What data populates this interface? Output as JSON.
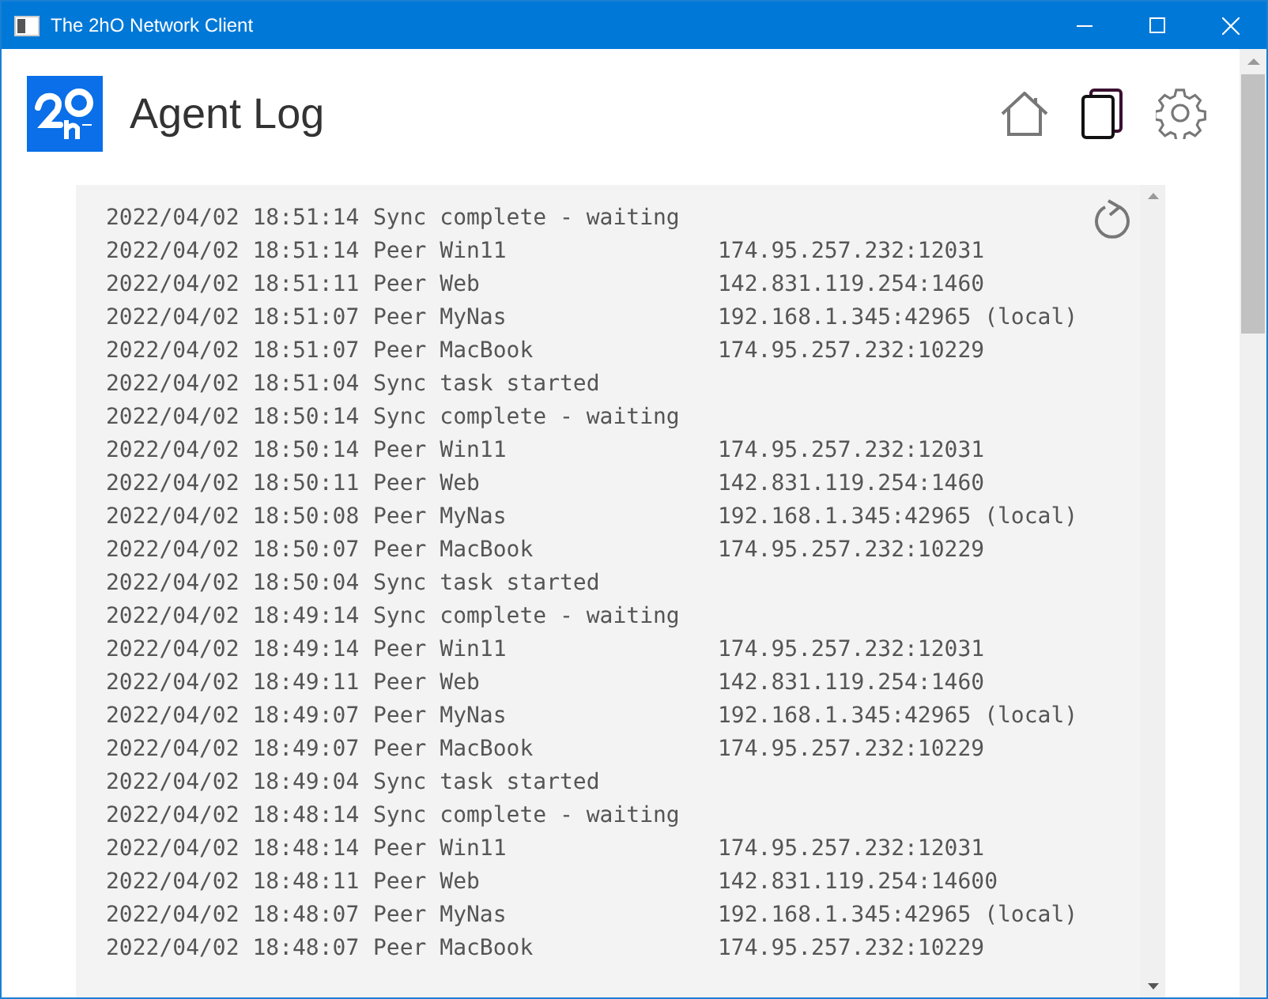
{
  "window": {
    "title": "The 2hO Network Client"
  },
  "header": {
    "title": "Agent Log"
  },
  "log": [
    {
      "time": "2022/04/02 18:51:14",
      "message": "Sync complete - waiting"
    },
    {
      "time": "2022/04/02 18:51:14",
      "message": "Peer Win11",
      "address": "174.95.257.232:12031"
    },
    {
      "time": "2022/04/02 18:51:11",
      "message": "Peer Web",
      "address": "142.831.119.254:1460"
    },
    {
      "time": "2022/04/02 18:51:07",
      "message": "Peer MyNas",
      "address": "192.168.1.345:42965 (local)"
    },
    {
      "time": "2022/04/02 18:51:07",
      "message": "Peer MacBook",
      "address": "174.95.257.232:10229"
    },
    {
      "time": "2022/04/02 18:51:04",
      "message": "Sync task started"
    },
    {
      "time": "2022/04/02 18:50:14",
      "message": "Sync complete - waiting"
    },
    {
      "time": "2022/04/02 18:50:14",
      "message": "Peer Win11",
      "address": "174.95.257.232:12031"
    },
    {
      "time": "2022/04/02 18:50:11",
      "message": "Peer Web",
      "address": "142.831.119.254:1460"
    },
    {
      "time": "2022/04/02 18:50:08",
      "message": "Peer MyNas",
      "address": "192.168.1.345:42965 (local)"
    },
    {
      "time": "2022/04/02 18:50:07",
      "message": "Peer MacBook",
      "address": "174.95.257.232:10229"
    },
    {
      "time": "2022/04/02 18:50:04",
      "message": "Sync task started"
    },
    {
      "time": "2022/04/02 18:49:14",
      "message": "Sync complete - waiting"
    },
    {
      "time": "2022/04/02 18:49:14",
      "message": "Peer Win11",
      "address": "174.95.257.232:12031"
    },
    {
      "time": "2022/04/02 18:49:11",
      "message": "Peer Web",
      "address": "142.831.119.254:1460"
    },
    {
      "time": "2022/04/02 18:49:07",
      "message": "Peer MyNas",
      "address": "192.168.1.345:42965 (local)"
    },
    {
      "time": "2022/04/02 18:49:07",
      "message": "Peer MacBook",
      "address": "174.95.257.232:10229"
    },
    {
      "time": "2022/04/02 18:49:04",
      "message": "Sync task started"
    },
    {
      "time": "2022/04/02 18:48:14",
      "message": "Sync complete - waiting"
    },
    {
      "time": "2022/04/02 18:48:14",
      "message": "Peer Win11",
      "address": "174.95.257.232:12031"
    },
    {
      "time": "2022/04/02 18:48:11",
      "message": "Peer Web",
      "address": "142.831.119.254:14600"
    },
    {
      "time": "2022/04/02 18:48:07",
      "message": "Peer MyNas",
      "address": "192.168.1.345:42965 (local)"
    },
    {
      "time": "2022/04/02 18:48:07",
      "message": "Peer MacBook",
      "address": "174.95.257.232:10229"
    }
  ]
}
